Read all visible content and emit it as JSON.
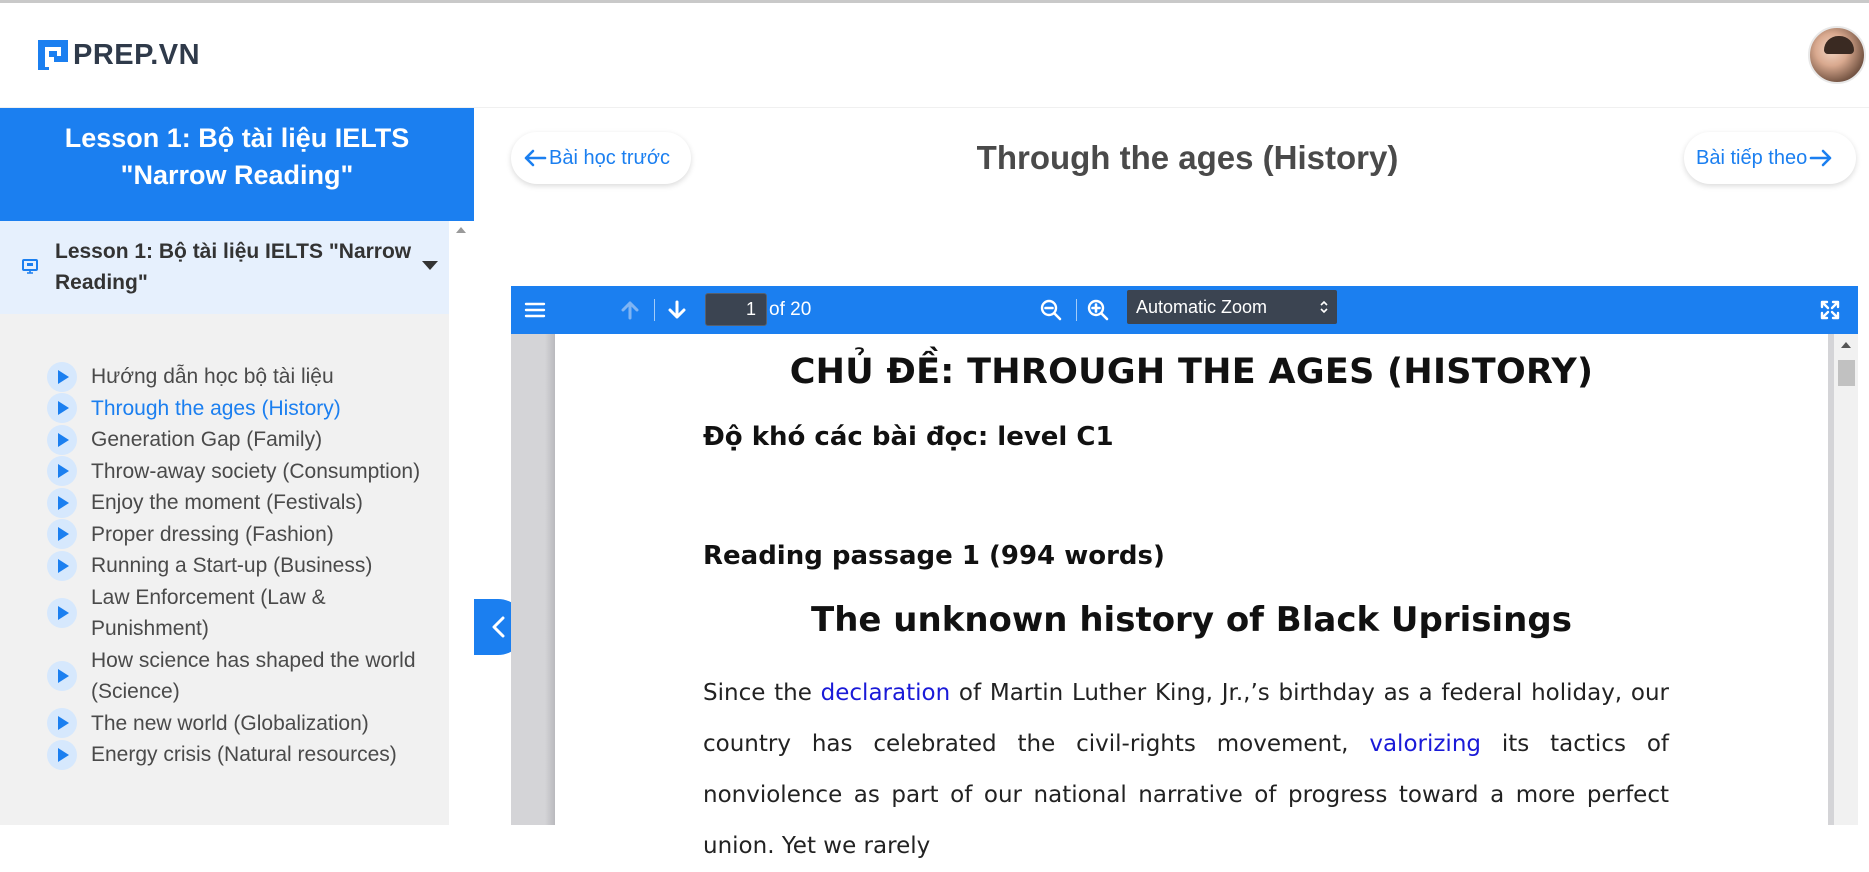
{
  "brand": {
    "name": "PREP.VN",
    "color": "#1b7ff0"
  },
  "sidebar": {
    "header_title": "Lesson 1: Bộ tài liệu IELTS \"Narrow Reading\"",
    "lesson_title": "Lesson 1: Bộ tài liệu IELTS \"Narrow Reading\"",
    "items": [
      {
        "label": "Hướng dẫn học bộ tài liệu",
        "active": false
      },
      {
        "label": "Through the ages (History)",
        "active": true
      },
      {
        "label": "Generation Gap (Family)",
        "active": false
      },
      {
        "label": "Throw-away society (Consumption)",
        "active": false
      },
      {
        "label": "Enjoy the moment (Festivals)",
        "active": false
      },
      {
        "label": "Proper dressing (Fashion)",
        "active": false
      },
      {
        "label": "Running a Start-up (Business)",
        "active": false
      },
      {
        "label": "Law Enforcement (Law & Punishment)",
        "active": false
      },
      {
        "label": "How science has shaped the world (Science)",
        "active": false
      },
      {
        "label": "The new world (Globalization)",
        "active": false
      },
      {
        "label": "Energy crisis (Natural resources)",
        "active": false
      }
    ]
  },
  "nav": {
    "prev_label": "Bài học trước",
    "next_label": "Bài tiếp theo",
    "page_title": "Through the ages (History)"
  },
  "viewer": {
    "page_number": "1",
    "page_count_label": "of 20",
    "zoom_label": "Automatic Zoom"
  },
  "document": {
    "heading": "CHỦ ĐỀ: THROUGH THE AGES (HISTORY)",
    "level": "Độ khó các bài đọc: level C1",
    "passage": "Reading passage 1 (994 words)",
    "article_title": "The unknown history of Black Uprisings",
    "body": [
      {
        "text": "Since the ",
        "vocab": false
      },
      {
        "text": "declaration",
        "vocab": true
      },
      {
        "text": " of Martin Luther King, Jr.,’s birthday as a federal holiday, our country has celebrated the civil-rights movement, ",
        "vocab": false
      },
      {
        "text": "valorizing",
        "vocab": true
      },
      {
        "text": " its tactics of nonviolence as part of our national narrative of progress toward a more perfect union. Yet we rarely",
        "vocab": false
      }
    ]
  }
}
